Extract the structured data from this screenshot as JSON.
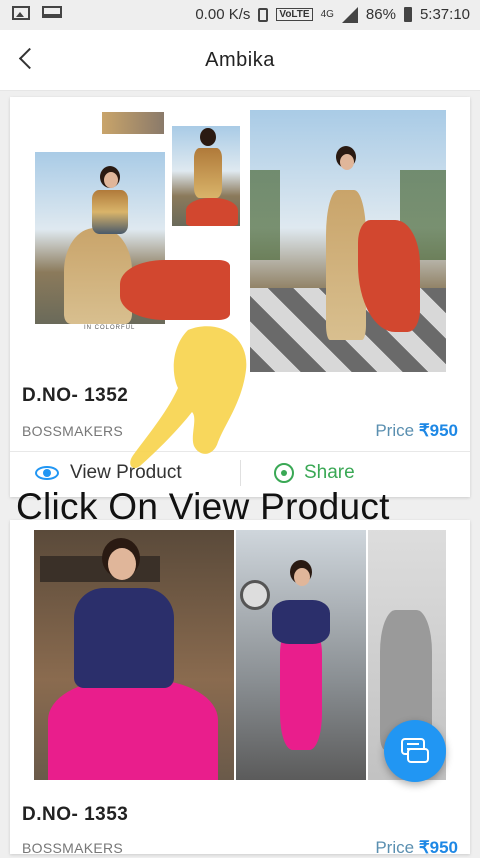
{
  "status_bar": {
    "speed": "0.00 K/s",
    "volte": "VoLTE",
    "network": "4G",
    "battery": "86%",
    "time": "5:37:10"
  },
  "app_bar": {
    "title": "Ambika"
  },
  "products": [
    {
      "code": "D.NO- 1352",
      "brand": "BOSSMAKERS",
      "price_label": "Price",
      "price": "₹950",
      "collage_caption": "IN COLORFUL"
    },
    {
      "code": "D.NO- 1353",
      "brand": "BOSSMAKERS",
      "price_label": "Price",
      "price": "₹950"
    }
  ],
  "actions": {
    "view": "View Product",
    "share": "Share"
  },
  "overlay": {
    "instruction": "Click On View Product"
  },
  "colors": {
    "accent": "#1e88e5",
    "share": "#3aa855",
    "fab": "#2196f3",
    "pointer": "#f7d34a"
  },
  "icons": [
    "back-arrow-icon",
    "eye-icon",
    "whatsapp-icon",
    "chat-icon",
    "hand-pointer-icon"
  ]
}
